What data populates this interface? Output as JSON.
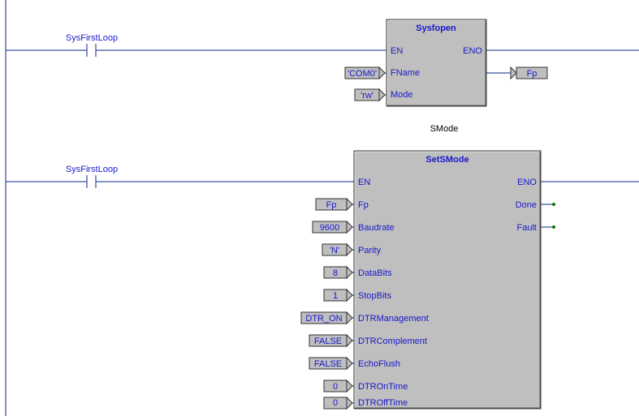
{
  "rung1": {
    "contact_label": "SysFirstLoop",
    "block": {
      "title": "Sysfopen",
      "inputs": [
        {
          "pin": "EN"
        },
        {
          "pin": "FName",
          "literal": "'COM0'"
        },
        {
          "pin": "Mode",
          "literal": "'rw'"
        }
      ],
      "outputs": [
        {
          "pin": "ENO"
        },
        {
          "pin": "",
          "var": "Fp"
        }
      ]
    }
  },
  "rung2": {
    "comment": "SMode",
    "contact_label": "SysFirstLoop",
    "block": {
      "title": "SetSMode",
      "inputs": [
        {
          "pin": "EN"
        },
        {
          "pin": "Fp",
          "var": "Fp"
        },
        {
          "pin": "Baudrate",
          "literal": "9600"
        },
        {
          "pin": "Parity",
          "literal": "'N'"
        },
        {
          "pin": "DataBits",
          "literal": "8"
        },
        {
          "pin": "StopBits",
          "literal": "1"
        },
        {
          "pin": "DTRManagement",
          "var": "DTR_ON"
        },
        {
          "pin": "DTRComplement",
          "literal": "FALSE"
        },
        {
          "pin": "EchoFlush",
          "literal": "FALSE"
        },
        {
          "pin": "DTROnTime",
          "literal": "0"
        },
        {
          "pin": "DTROffTime",
          "literal": "0"
        }
      ],
      "outputs": [
        {
          "pin": "ENO"
        },
        {
          "pin": "Done"
        },
        {
          "pin": "Fault"
        }
      ]
    }
  }
}
